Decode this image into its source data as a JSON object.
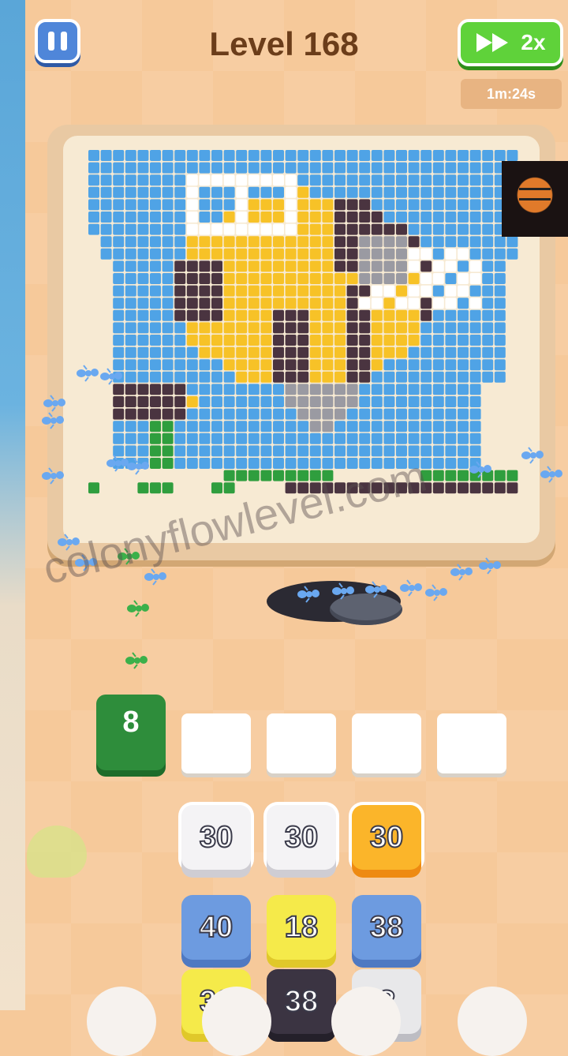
{
  "header": {
    "level_title": "Level 168",
    "speed_label": "2x",
    "timer": "1m:24s"
  },
  "watermark": "colonyflowlevel.com",
  "slots": {
    "active_count": "8",
    "empty_count": 4
  },
  "tiles": [
    {
      "label": "30",
      "color": "white"
    },
    {
      "label": "30",
      "color": "white"
    },
    {
      "label": "30",
      "color": "orange"
    },
    {
      "label": "40",
      "color": "blue"
    },
    {
      "label": "18",
      "color": "yellow"
    },
    {
      "label": "38",
      "color": "blue"
    },
    {
      "label": "30",
      "color": "yellow"
    },
    {
      "label": "38",
      "color": "dark"
    },
    {
      "label": "?",
      "color": "mystery"
    }
  ],
  "colors": {
    "sky": "#4fa3e6",
    "bee_yellow": "#f7c227",
    "bee_dark": "#4a3440",
    "wing_white": "#ffffff",
    "grass_green": "#2f9e3e",
    "mystery_gray": "#9a9aa2",
    "board_bg": "#f7ead3"
  }
}
